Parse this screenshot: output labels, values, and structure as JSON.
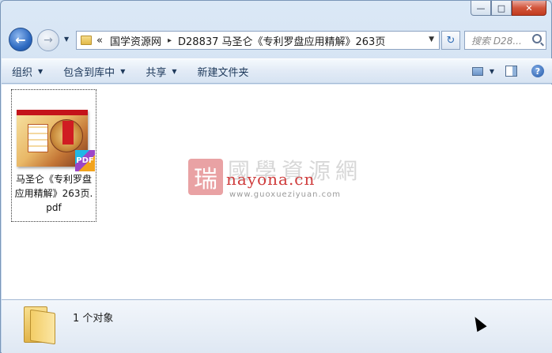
{
  "window": {
    "minimize_glyph": "—",
    "maximize_glyph": "□",
    "close_glyph": "✕"
  },
  "nav": {
    "back_glyph": "←",
    "forward_glyph": "→",
    "history_glyph": "▼",
    "refresh_glyph": "↻"
  },
  "address": {
    "overflow": "«",
    "crumbs": [
      "国学资源网",
      "D28837 马圣仑《专利罗盘应用精解》263页"
    ],
    "separator": "▸",
    "dropdown": "▼"
  },
  "search": {
    "placeholder": "搜索 D28..."
  },
  "commands": {
    "organize": "组织",
    "include_library": "包含到库中",
    "share": "共享",
    "new_folder": "新建文件夹",
    "arrow": "▼",
    "help": "?"
  },
  "files": [
    {
      "name": "马圣仑《专利罗盘应用精解》263页.pdf",
      "badge": "PDF",
      "icon": "pdf-file-icon"
    }
  ],
  "watermark": {
    "seal": "瑞",
    "chinese": "國學資源網",
    "site": "nayona.cn",
    "url": "www.guoxueziyuan.com"
  },
  "status": {
    "count": "1 个对象"
  }
}
